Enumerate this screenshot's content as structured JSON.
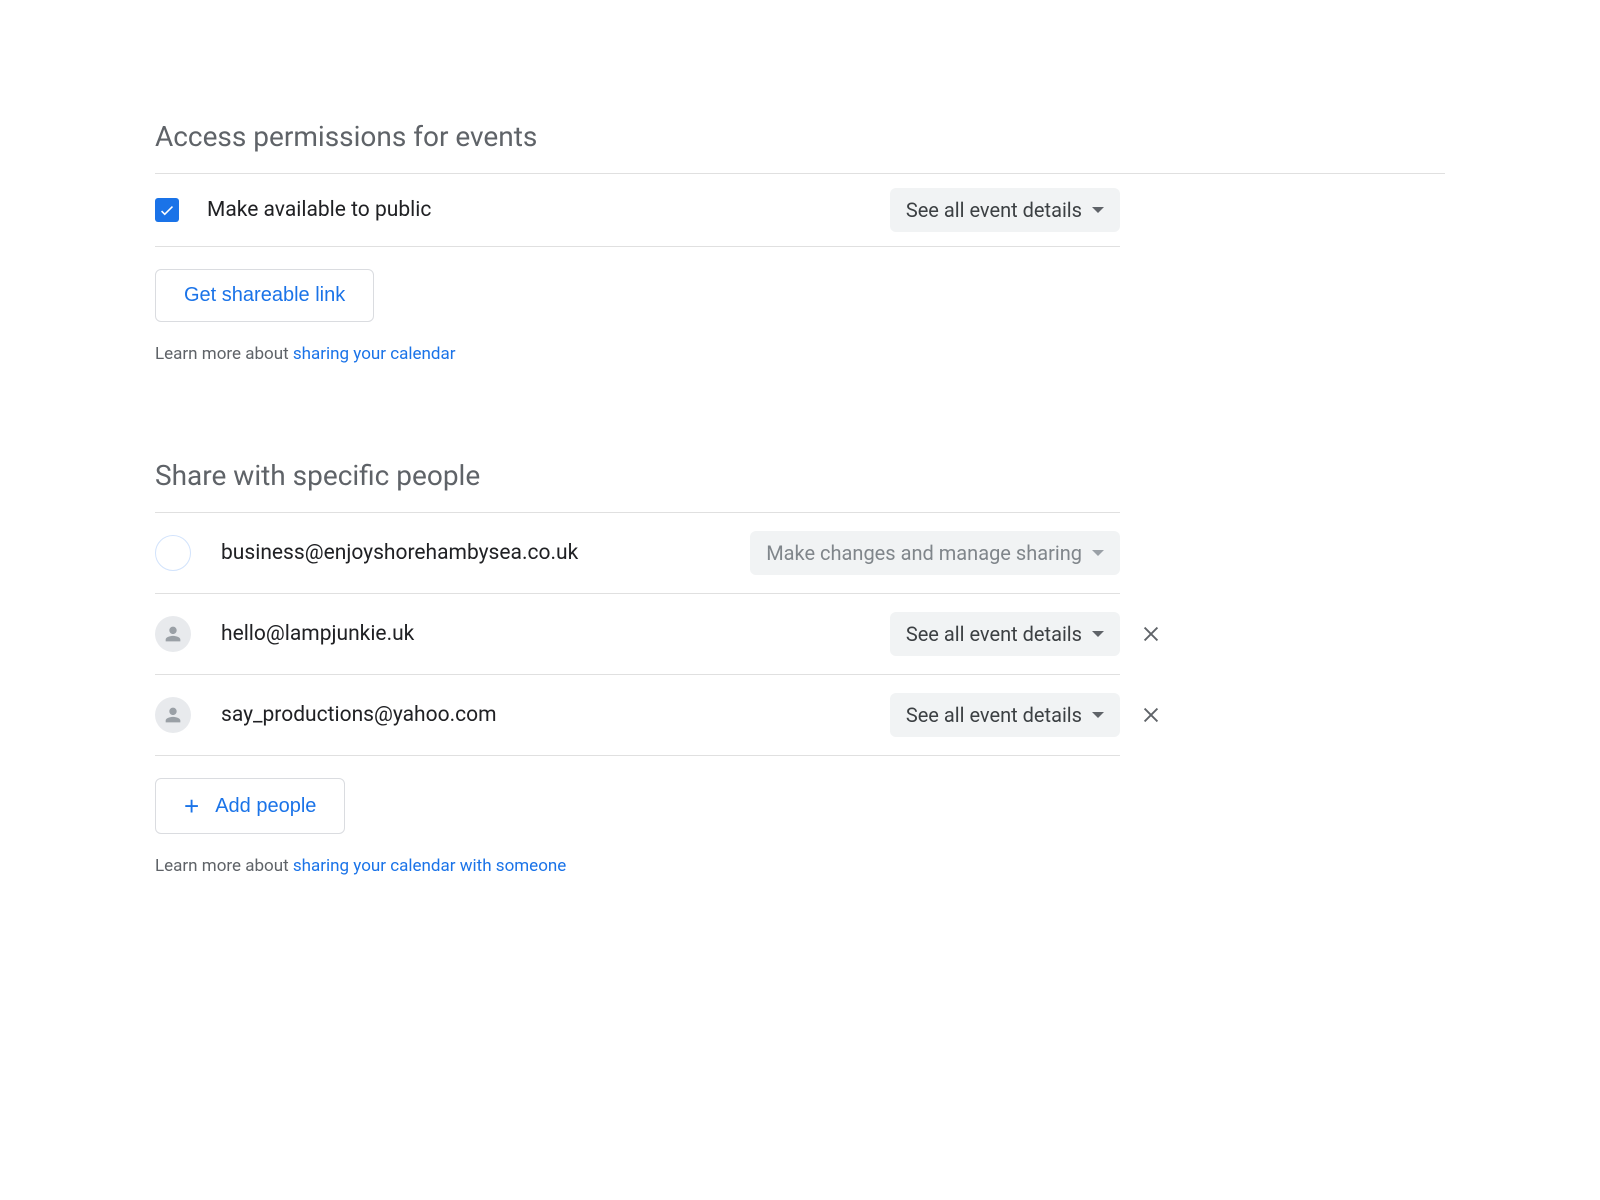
{
  "access": {
    "title": "Access permissions for events",
    "makePublicLabel": "Make available to public",
    "publicDropdown": "See all event details",
    "shareLinkBtn": "Get shareable link",
    "helpPrefix": "Learn more about ",
    "helpLink": "sharing your calendar"
  },
  "share": {
    "title": "Share with specific people",
    "people": [
      {
        "email": "business@enjoyshorehambysea.co.uk",
        "permission": "Make changes and manage sharing",
        "disabled": true,
        "removable": false,
        "customAvatar": true
      },
      {
        "email": "hello@lampjunkie.uk",
        "permission": "See all event details",
        "disabled": false,
        "removable": true,
        "customAvatar": false
      },
      {
        "email": "say_productions@yahoo.com",
        "permission": "See all event details",
        "disabled": false,
        "removable": true,
        "customAvatar": false
      }
    ],
    "addPeopleBtn": "Add people",
    "helpPrefix": "Learn more about ",
    "helpLink": "sharing your calendar with someone"
  }
}
